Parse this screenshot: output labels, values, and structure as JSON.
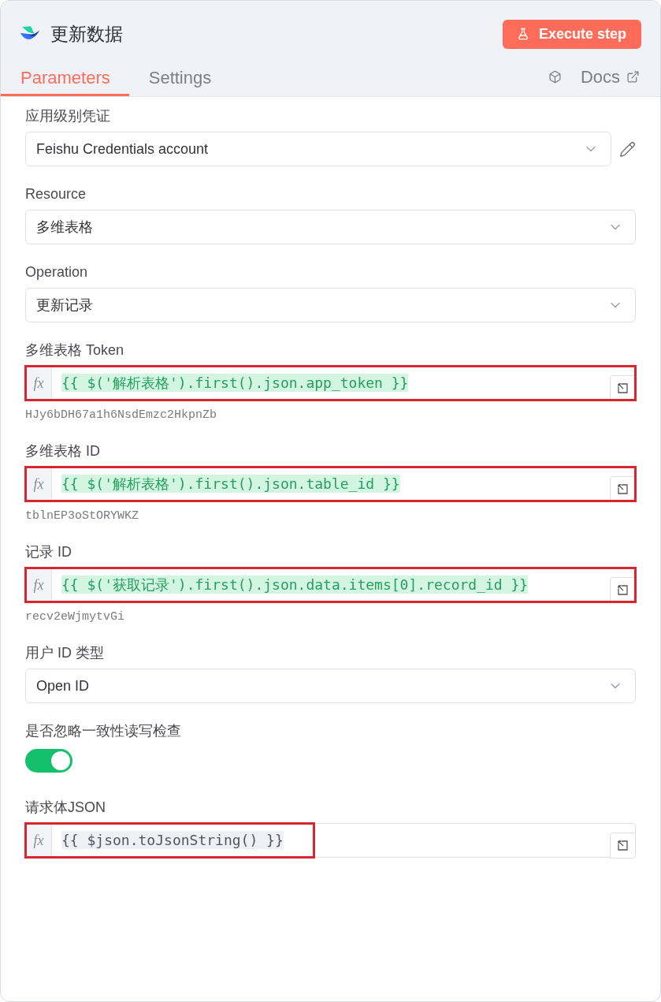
{
  "header": {
    "title": "更新数据",
    "action_button": {
      "label": "Execute step"
    }
  },
  "tabs": [
    {
      "label": "Parameters",
      "selected": true
    },
    {
      "label": "Settings",
      "selected": false
    }
  ],
  "docs_link": {
    "label": "Docs"
  },
  "fields": [
    {
      "kind": "select",
      "label": "应用级别凭证",
      "value": "Feishu Credentials account",
      "editable": true
    },
    {
      "kind": "select",
      "label": "Resource",
      "value": "多维表格",
      "editable": false
    },
    {
      "kind": "select",
      "label": "Operation",
      "value": "更新记录",
      "editable": false
    },
    {
      "kind": "expression",
      "label": "多维表格 Token",
      "prefix": "fx",
      "value": "{{ $('解析表格').first().json.app_token }}",
      "resolved": true,
      "hint": "HJy6bDH67a1h6NsdEmzc2HkpnZb",
      "annotation": {
        "outlined": true,
        "full_width": true
      }
    },
    {
      "kind": "expression",
      "label": "多维表格 ID",
      "prefix": "fx",
      "value": "{{ $('解析表格').first().json.table_id }}",
      "resolved": true,
      "hint": "tblnEP3oStORYWKZ",
      "annotation": {
        "outlined": true,
        "full_width": true
      }
    },
    {
      "kind": "expression",
      "label": "记录 ID",
      "prefix": "fx",
      "value": "{{ $('获取记录').first().json.data.items[0].record_id }}",
      "resolved": true,
      "hint": "recv2eWjmytvGi",
      "annotation": {
        "outlined": true,
        "full_width": true
      }
    },
    {
      "kind": "select",
      "label": "用户 ID 类型",
      "value": "Open ID",
      "editable": false
    },
    {
      "kind": "switch",
      "label": "是否忽略一致性读写检查",
      "on": true
    },
    {
      "kind": "expression",
      "label": "请求体JSON",
      "prefix": "fx",
      "value": "{{ $json.toJsonString() }}",
      "resolved": false,
      "annotation": {
        "outlined": true,
        "full_width": false
      }
    }
  ]
}
